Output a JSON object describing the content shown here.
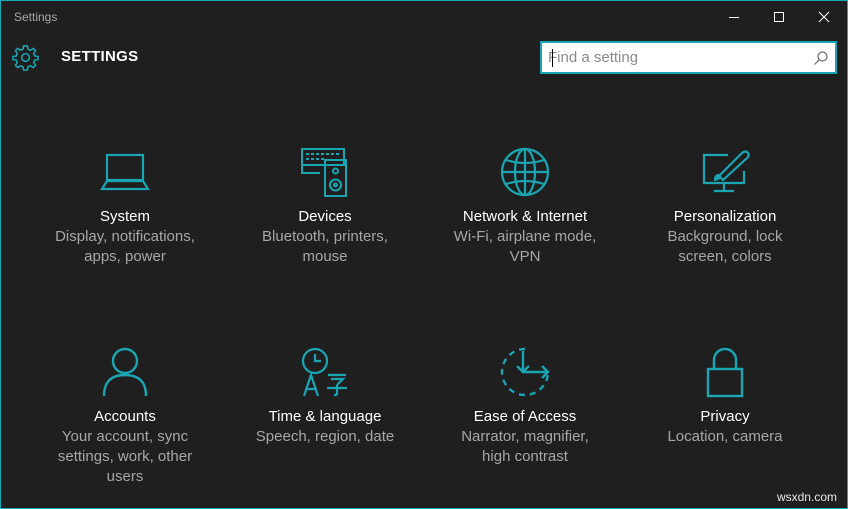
{
  "window": {
    "title": "Settings"
  },
  "header": {
    "title": "SETTINGS",
    "icon": "gear-icon"
  },
  "search": {
    "placeholder": "Find a setting",
    "value": "",
    "icon": "search-icon"
  },
  "tiles": [
    {
      "name": "System",
      "desc": "Display, notifications, apps, power",
      "icon": "laptop-icon"
    },
    {
      "name": "Devices",
      "desc": "Bluetooth, printers, mouse",
      "icon": "keyboard-speaker-icon"
    },
    {
      "name": "Network & Internet",
      "desc": "Wi-Fi, airplane mode, VPN",
      "icon": "globe-icon"
    },
    {
      "name": "Personalization",
      "desc": "Background, lock screen, colors",
      "icon": "paintbrush-monitor-icon"
    },
    {
      "name": "Accounts",
      "desc": "Your account, sync settings, work, other users",
      "icon": "person-icon"
    },
    {
      "name": "Time & language",
      "desc": "Speech, region, date",
      "icon": "clock-language-icon"
    },
    {
      "name": "Ease of Access",
      "desc": "Narrator, magnifier, high contrast",
      "icon": "ease-of-access-icon"
    },
    {
      "name": "Privacy",
      "desc": "Location, camera",
      "icon": "lock-icon"
    }
  ],
  "watermark": "wsxdn.com",
  "colors": {
    "accent": "#1aa5b3",
    "background": "#1f1f1f",
    "text": "#ffffff",
    "subtext": "#a7a7a7"
  }
}
